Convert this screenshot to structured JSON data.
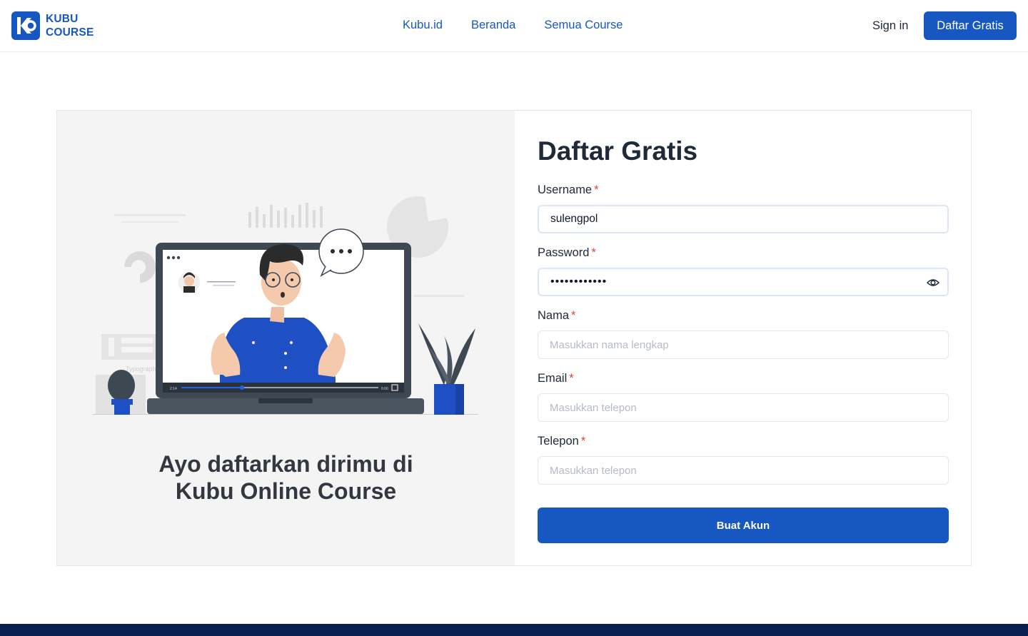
{
  "brand": {
    "line1": "KUBU",
    "line2": "COURSE",
    "color": "#1657c1"
  },
  "nav": {
    "items": [
      "Kubu.id",
      "Beranda",
      "Semua Course"
    ]
  },
  "header": {
    "signin_label": "Sign in",
    "cta_label": "Daftar Gratis"
  },
  "hero": {
    "line1": "Ayo daftarkan dirimu di",
    "line2": "Kubu Online Course",
    "video": {
      "time_current": "2:14",
      "time_total": "6:00"
    },
    "sign_text": "Typography"
  },
  "form": {
    "title": "Daftar Gratis",
    "username": {
      "label": "Username",
      "value": "sulengpol"
    },
    "password": {
      "label": "Password",
      "value": "••••••••••••"
    },
    "nama": {
      "label": "Nama",
      "placeholder": "Masukkan nama lengkap"
    },
    "email": {
      "label": "Email",
      "placeholder": "Masukkan telepon"
    },
    "telepon": {
      "label": "Telepon",
      "placeholder": "Masukkan telepon"
    },
    "required_mark": "*",
    "submit_label": "Buat Akun"
  },
  "icons": {
    "password_toggle": "eye-icon",
    "logo": "kubu-logo-icon"
  },
  "colors": {
    "primary": "#1657c1",
    "required": "#d9473b",
    "footer": "#0a1f4d"
  }
}
